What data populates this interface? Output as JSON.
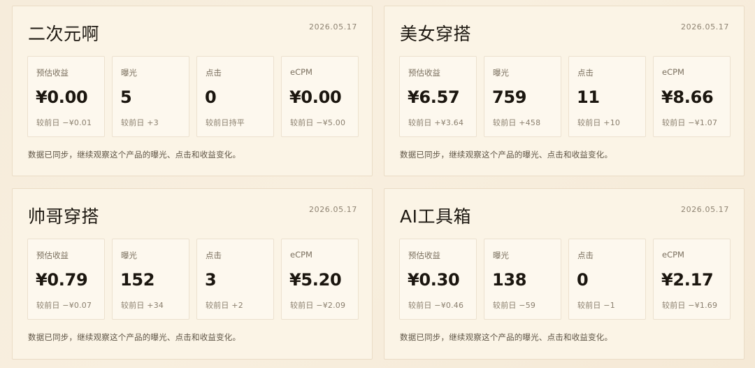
{
  "cards": [
    {
      "title": "二次元啊",
      "date": "2026.05.17",
      "metrics": [
        {
          "label": "预估收益",
          "value": "¥0.00",
          "change": "较前日 −¥0.01"
        },
        {
          "label": "曝光",
          "value": "5",
          "change": "较前日 +3"
        },
        {
          "label": "点击",
          "value": "0",
          "change": "较前日持平"
        },
        {
          "label": "eCPM",
          "value": "¥0.00",
          "change": "较前日 −¥5.00"
        }
      ],
      "note": "数据已同步，继续观察这个产品的曝光、点击和收益变化。"
    },
    {
      "title": "美女穿搭",
      "date": "2026.05.17",
      "metrics": [
        {
          "label": "预估收益",
          "value": "¥6.57",
          "change": "较前日 +¥3.64"
        },
        {
          "label": "曝光",
          "value": "759",
          "change": "较前日 +458"
        },
        {
          "label": "点击",
          "value": "11",
          "change": "较前日 +10"
        },
        {
          "label": "eCPM",
          "value": "¥8.66",
          "change": "较前日 −¥1.07"
        }
      ],
      "note": "数据已同步，继续观察这个产品的曝光、点击和收益变化。"
    },
    {
      "title": "帅哥穿搭",
      "date": "2026.05.17",
      "metrics": [
        {
          "label": "预估收益",
          "value": "¥0.79",
          "change": "较前日 −¥0.07"
        },
        {
          "label": "曝光",
          "value": "152",
          "change": "较前日 +34"
        },
        {
          "label": "点击",
          "value": "3",
          "change": "较前日 +2"
        },
        {
          "label": "eCPM",
          "value": "¥5.20",
          "change": "较前日 −¥2.09"
        }
      ],
      "note": "数据已同步，继续观察这个产品的曝光、点击和收益变化。"
    },
    {
      "title": "AI工具箱",
      "date": "2026.05.17",
      "metrics": [
        {
          "label": "预估收益",
          "value": "¥0.30",
          "change": "较前日 −¥0.46"
        },
        {
          "label": "曝光",
          "value": "138",
          "change": "较前日 −59"
        },
        {
          "label": "点击",
          "value": "0",
          "change": "较前日 −1"
        },
        {
          "label": "eCPM",
          "value": "¥2.17",
          "change": "较前日 −¥1.69"
        }
      ],
      "note": "数据已同步，继续观察这个产品的曝光、点击和收益变化。"
    }
  ],
  "colors": {
    "background": "#f6ecdb",
    "card": "#fbf4e6",
    "card_border": "#eadcc6",
    "metric_box": "#fdf8ee",
    "title_text": "#1e1912",
    "muted_text": "#8a7f6e"
  }
}
